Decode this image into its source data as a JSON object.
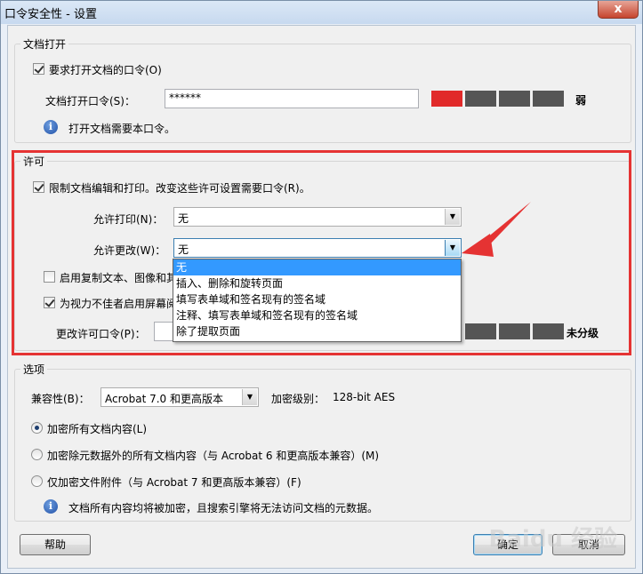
{
  "window": {
    "title": "口令安全性 - 设置",
    "close_label": "x"
  },
  "doc_open": {
    "group_label": "文档打开",
    "require_password_label": "要求打开文档的口令(O)",
    "password_label": "文档打开口令(S)：",
    "password_value": "******",
    "strength_text": "弱",
    "strength_level": 0.25,
    "info_text": "打开文档需要本口令。"
  },
  "permissions": {
    "group_label": "许可",
    "restrict_label": "限制文档编辑和打印。改变这些许可设置需要口令(R)。",
    "allow_print_label": "允许打印(N)：",
    "allow_print_value": "无",
    "allow_change_label": "允许更改(W)：",
    "allow_change_value": "无",
    "change_options": [
      "无",
      "插入、删除和旋转页面",
      "填写表单域和签名现有的签名域",
      "注释、填写表单域和签名现有的签名域",
      "除了提取页面"
    ],
    "enable_copy_label": "启用复制文本、图像和其",
    "enable_screen_reader_label": "为视力不佳者启用屏幕阅",
    "change_password_label": "更改许可口令(P)：",
    "change_password_value": "",
    "strength_text": "未分级"
  },
  "options": {
    "group_label": "选项",
    "compat_label": "兼容性(B)：",
    "compat_value": "Acrobat 7.0 和更高版本",
    "encrypt_level_label": "加密级别：",
    "encrypt_level_value": "128-bit AES",
    "radio_all": "加密所有文档内容(L)",
    "radio_except_meta": "加密除元数据外的所有文档内容（与 Acrobat 6 和更高版本兼容）(M)",
    "radio_attachments": "仅加密文件附件（与 Acrobat 7 和更高版本兼容）(F)",
    "info_text": "文档所有内容均将被加密，且搜索引擎将无法访问文档的元数据。"
  },
  "buttons": {
    "help": "帮助",
    "ok": "确定",
    "cancel": "取消"
  },
  "watermark": "Baidu 经验",
  "colors": {
    "strength_weak": "#e12a2a",
    "strength_empty": "#555555",
    "selection": "#3399ff",
    "annotation": "#e53333"
  }
}
